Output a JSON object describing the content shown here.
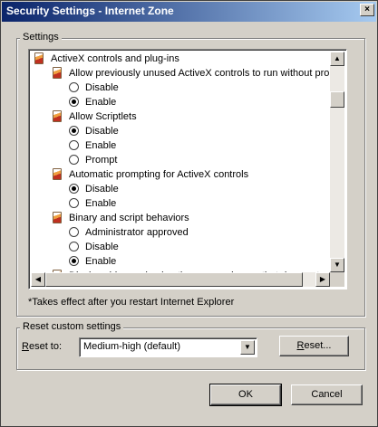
{
  "window": {
    "title": "Security Settings - Internet Zone",
    "close_glyph": "×"
  },
  "settings_group": {
    "label": "Settings"
  },
  "tree": [
    {
      "type": "category",
      "label": "ActiveX controls and plug-ins"
    },
    {
      "type": "setting",
      "label": "Allow previously unused ActiveX controls to run without promp"
    },
    {
      "type": "option",
      "label": "Disable",
      "checked": false
    },
    {
      "type": "option",
      "label": "Enable",
      "checked": true
    },
    {
      "type": "setting",
      "label": "Allow Scriptlets"
    },
    {
      "type": "option",
      "label": "Disable",
      "checked": true
    },
    {
      "type": "option",
      "label": "Enable",
      "checked": false
    },
    {
      "type": "option",
      "label": "Prompt",
      "checked": false
    },
    {
      "type": "setting",
      "label": "Automatic prompting for ActiveX controls"
    },
    {
      "type": "option",
      "label": "Disable",
      "checked": true
    },
    {
      "type": "option",
      "label": "Enable",
      "checked": false
    },
    {
      "type": "setting",
      "label": "Binary and script behaviors"
    },
    {
      "type": "option",
      "label": "Administrator approved",
      "checked": false
    },
    {
      "type": "option",
      "label": "Disable",
      "checked": false
    },
    {
      "type": "option",
      "label": "Enable",
      "checked": true
    },
    {
      "type": "setting",
      "label": "Display video and animation on a webpage that does not use"
    }
  ],
  "note": "*Takes effect after you restart Internet Explorer",
  "reset_group": {
    "label": "Reset custom settings",
    "reset_to_label_u": "R",
    "reset_to_label_rest": "eset to:",
    "level_value": "Medium-high (default)",
    "reset_button_u": "R",
    "reset_button_rest": "eset..."
  },
  "buttons": {
    "ok": "OK",
    "cancel": "Cancel"
  },
  "colors": {
    "title_start": "#0a246a",
    "title_end": "#a6caf0",
    "face": "#d4d0c8"
  }
}
